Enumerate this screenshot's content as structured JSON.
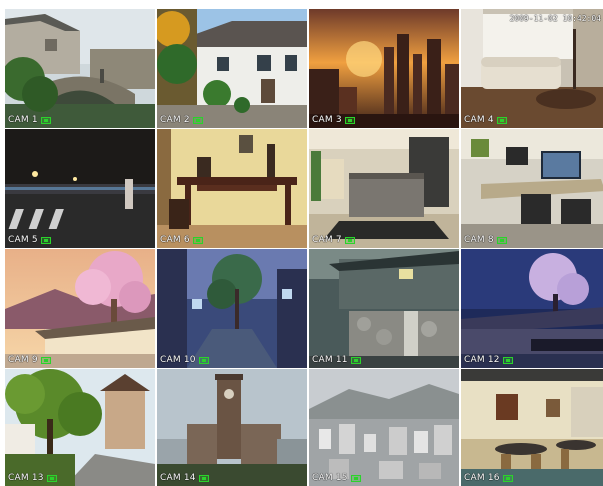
{
  "cameras": [
    {
      "label": "CAM 1",
      "icon": "record-icon",
      "scene": "bridge"
    },
    {
      "label": "CAM 2",
      "icon": "record-icon",
      "scene": "cottage"
    },
    {
      "label": "CAM 3",
      "icon": "record-icon",
      "scene": "sunset-city"
    },
    {
      "label": "CAM 4",
      "icon": "record-icon",
      "scene": "living-room",
      "timestamp": "2009-11-02 10:42:04"
    },
    {
      "label": "CAM 5",
      "icon": "record-icon",
      "scene": "night-street"
    },
    {
      "label": "CAM 6",
      "icon": "record-icon",
      "scene": "hallway-table"
    },
    {
      "label": "CAM 7",
      "icon": "record-icon",
      "scene": "modern-kitchen"
    },
    {
      "label": "CAM 8",
      "icon": "record-icon",
      "scene": "office-desk"
    },
    {
      "label": "CAM 9",
      "icon": "record-icon",
      "scene": "blossom-house"
    },
    {
      "label": "CAM 10",
      "icon": "record-icon",
      "scene": "alley-dusk"
    },
    {
      "label": "CAM 11",
      "icon": "record-icon",
      "scene": "stone-wall-house"
    },
    {
      "label": "CAM 12",
      "icon": "record-icon",
      "scene": "night-blossom"
    },
    {
      "label": "CAM 13",
      "icon": "record-icon",
      "scene": "tree-path"
    },
    {
      "label": "CAM 14",
      "icon": "record-icon",
      "scene": "clock-tower"
    },
    {
      "label": "CAM 15",
      "icon": "record-icon",
      "scene": "hazy-city"
    },
    {
      "label": "CAM 16",
      "icon": "record-icon",
      "scene": "cafe-interior"
    }
  ],
  "colors": {
    "record_indicator": "#2bd32b",
    "label_text": "#ffffff",
    "background": "#ffffff"
  }
}
